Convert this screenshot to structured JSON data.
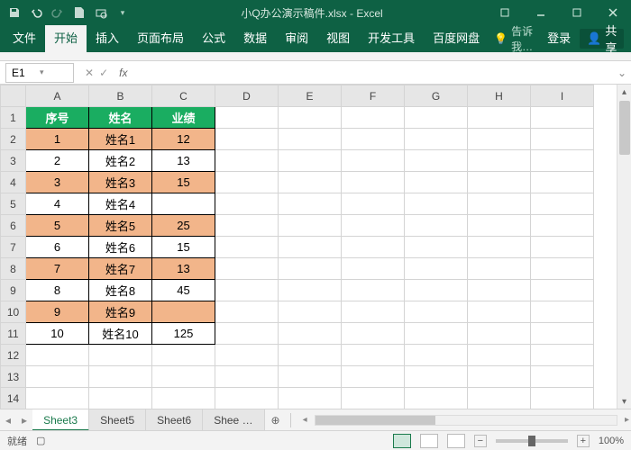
{
  "window": {
    "title": "小Q办公演示稿件.xlsx - Excel"
  },
  "ribbon": {
    "tabs": [
      "文件",
      "开始",
      "插入",
      "页面布局",
      "公式",
      "数据",
      "审阅",
      "视图",
      "开发工具",
      "百度网盘"
    ],
    "active_index": 1,
    "tell_me": "告诉我…",
    "login": "登录",
    "share": "共享"
  },
  "namebox": {
    "value": "E1"
  },
  "formula": {
    "label": "fx",
    "value": ""
  },
  "columns": [
    "A",
    "B",
    "C",
    "D",
    "E",
    "F",
    "G",
    "H",
    "I"
  ],
  "row_count": 14,
  "table": {
    "headers": [
      "序号",
      "姓名",
      "业绩"
    ],
    "rows": [
      {
        "n": "1",
        "name": "姓名1",
        "val": "12",
        "hl": true
      },
      {
        "n": "2",
        "name": "姓名2",
        "val": "13",
        "hl": false
      },
      {
        "n": "3",
        "name": "姓名3",
        "val": "15",
        "hl": true
      },
      {
        "n": "4",
        "name": "姓名4",
        "val": "",
        "hl": false
      },
      {
        "n": "5",
        "name": "姓名5",
        "val": "25",
        "hl": true
      },
      {
        "n": "6",
        "name": "姓名6",
        "val": "15",
        "hl": false
      },
      {
        "n": "7",
        "name": "姓名7",
        "val": "13",
        "hl": true
      },
      {
        "n": "8",
        "name": "姓名8",
        "val": "45",
        "hl": false
      },
      {
        "n": "9",
        "name": "姓名9",
        "val": "",
        "hl": true
      },
      {
        "n": "10",
        "name": "姓名10",
        "val": "125",
        "hl": false
      }
    ]
  },
  "sheets": {
    "tabs": [
      "Sheet3",
      "Sheet5",
      "Sheet6",
      "Shee …"
    ],
    "active_index": 0
  },
  "status": {
    "mode": "就绪",
    "extra": "",
    "zoom": "100%"
  }
}
